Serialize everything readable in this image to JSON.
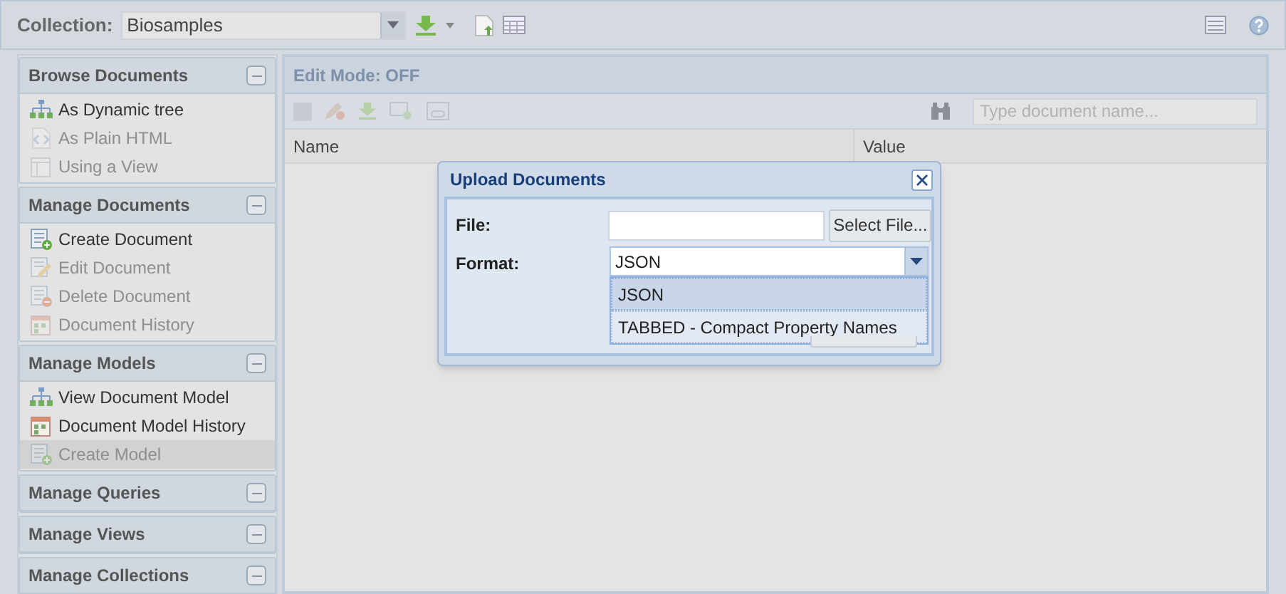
{
  "collection": {
    "label": "Collection:",
    "value": "Biosamples"
  },
  "sidebar": {
    "sections": [
      {
        "title": "Browse Documents",
        "items": [
          {
            "label": "As Dynamic tree",
            "kind": "tree",
            "disabled": false,
            "selected": false
          },
          {
            "label": "As Plain HTML",
            "kind": "html",
            "disabled": true,
            "selected": false
          },
          {
            "label": "Using a View",
            "kind": "view",
            "disabled": true,
            "selected": false
          }
        ]
      },
      {
        "title": "Manage Documents",
        "items": [
          {
            "label": "Create Document",
            "kind": "doc-add",
            "disabled": false,
            "selected": false
          },
          {
            "label": "Edit Document",
            "kind": "doc-edit",
            "disabled": true,
            "selected": false
          },
          {
            "label": "Delete Document",
            "kind": "doc-delete",
            "disabled": true,
            "selected": false
          },
          {
            "label": "Document History",
            "kind": "history",
            "disabled": true,
            "selected": false
          }
        ]
      },
      {
        "title": "Manage Models",
        "items": [
          {
            "label": "View Document Model",
            "kind": "tree",
            "disabled": false,
            "selected": false
          },
          {
            "label": "Document Model History",
            "kind": "history",
            "disabled": false,
            "selected": false
          },
          {
            "label": "Create Model",
            "kind": "doc-add",
            "disabled": true,
            "selected": true
          }
        ]
      },
      {
        "title": "Manage Queries"
      },
      {
        "title": "Manage Views"
      },
      {
        "title": "Manage Collections"
      }
    ]
  },
  "main": {
    "title": "Edit Mode: OFF",
    "search": {
      "placeholder": "Type document name..."
    },
    "columns": [
      "Name",
      "Value"
    ]
  },
  "dialog": {
    "title": "Upload Documents",
    "file_label": "File:",
    "select_button": "Select File...",
    "format_label": "Format:",
    "format_value": "JSON",
    "options": [
      {
        "label": "JSON",
        "selected": true
      },
      {
        "label": "TABBED - Compact Property Names",
        "selected": false
      }
    ]
  }
}
